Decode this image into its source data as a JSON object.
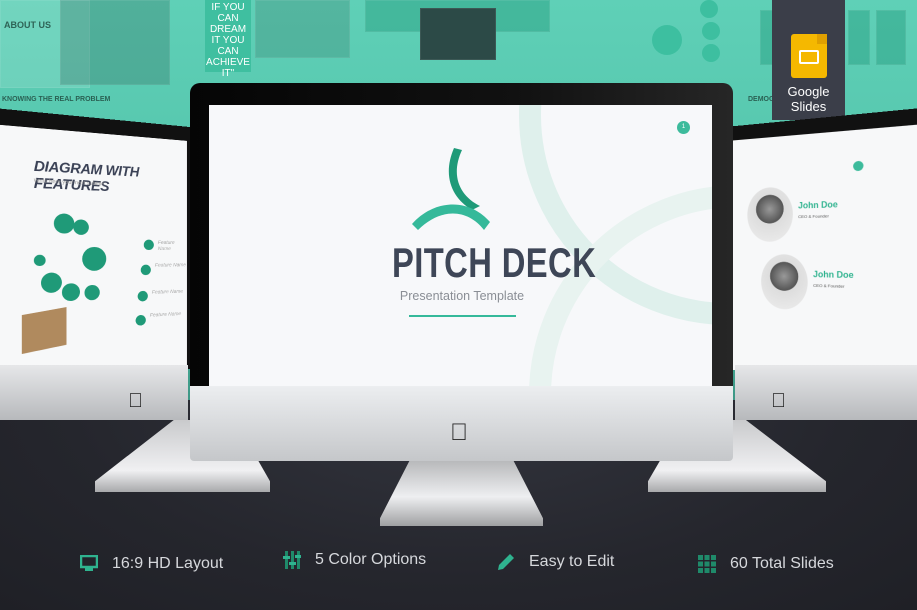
{
  "background_slides": {
    "about_title": "ABOUT US",
    "quote": "IF YOU CAN DREAM IT YOU CAN ACHIEVE IT\"",
    "problem_title": "KNOWING THE REAL PROBLEM",
    "demographic_title": "DEMOG"
  },
  "badge": {
    "label_line1": "Google",
    "label_line2": "Slides",
    "icon": "google-slides-icon",
    "color": "#f5b800"
  },
  "main_slide": {
    "page_number": "1",
    "title": "PITCH DECK",
    "subtitle": "Presentation Template",
    "accent": "#35b99a"
  },
  "left_slide": {
    "title": "DIAGRAM WITH FEATURES",
    "subtitle": "Write here your next subtitle",
    "features": [
      "Feature Name",
      "Feature Name",
      "Feature Name",
      "Feature Name"
    ]
  },
  "right_slide": {
    "people": [
      {
        "name": "John Doe",
        "role": "CEO & Founder"
      },
      {
        "name": "John Doe",
        "role": "CEO & Founder"
      }
    ]
  },
  "features": [
    {
      "icon": "monitor-icon",
      "label": "16:9 HD Layout"
    },
    {
      "icon": "sliders-icon",
      "label": "5 Color Options"
    },
    {
      "icon": "pencil-icon",
      "label": "Easy to Edit"
    },
    {
      "icon": "grid-icon",
      "label": "60 Total Slides"
    }
  ],
  "colors": {
    "teal": "#5fd0b7",
    "dark": "#25262d",
    "icon": "#2fb38f"
  }
}
